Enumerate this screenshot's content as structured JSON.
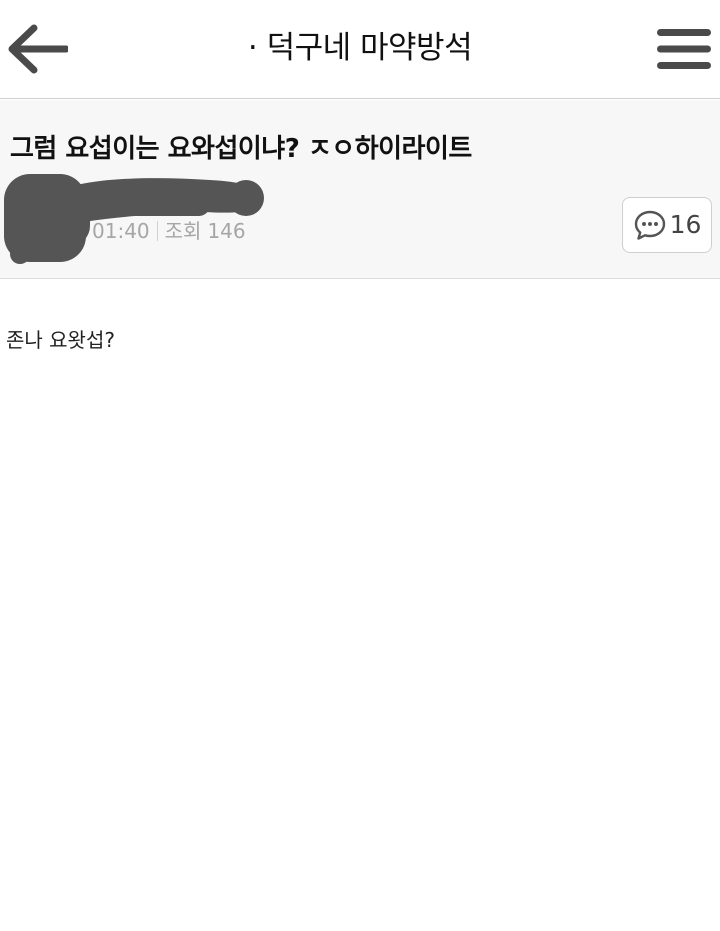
{
  "header": {
    "board_title": "· 덕구네 마약방석",
    "back_icon": "arrow-left-icon",
    "menu_icon": "hamburger-menu-icon"
  },
  "post": {
    "title": "그럼 요섭이는 요와섭이냐? ㅈㅇ하이라이트",
    "time": "01:40",
    "views_label": "조회",
    "views": "146",
    "comment_icon": "speech-bubble-icon",
    "comment_count": "16"
  },
  "content": {
    "body": "존나 요왓섭?"
  }
}
